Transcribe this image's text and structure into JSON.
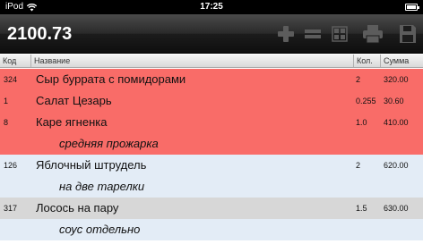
{
  "status_bar": {
    "carrier": "iPod",
    "time": "17:25"
  },
  "toolbar": {
    "total": "2100.73",
    "buttons": [
      {
        "icon": "plus-icon"
      },
      {
        "icon": "list-icon"
      },
      {
        "icon": "grid-icon"
      },
      {
        "icon": "printer-icon"
      },
      {
        "icon": "save-icon"
      }
    ]
  },
  "table": {
    "headers": {
      "code": "Код",
      "name": "Название",
      "qty": "Кол.",
      "sum": "Сумма"
    },
    "rows": [
      {
        "code": "324",
        "name": "Сыр буррата с помидорами",
        "qty": "2",
        "sum": "320.00",
        "color": "#f96c68"
      },
      {
        "code": "1",
        "name": "Салат Цезарь",
        "qty": "0.255",
        "sum": "30.60",
        "color": "#f96c68"
      },
      {
        "code": "8",
        "name": "Каре ягненка",
        "qty": "1.0",
        "sum": "410.00",
        "color": "#f96c68"
      },
      {
        "code": "",
        "name": "средняя прожарка",
        "qty": "",
        "sum": "",
        "note": true,
        "color": "#f96c68"
      },
      {
        "code": "126",
        "name": "Яблочный штрудель",
        "qty": "2",
        "sum": "620.00",
        "color": "#e3ecf6"
      },
      {
        "code": "",
        "name": "на две тарелки",
        "qty": "",
        "sum": "",
        "note": true,
        "color": "#e3ecf6"
      },
      {
        "code": "317",
        "name": "Лосось на пару",
        "qty": "1.5",
        "sum": "630.00",
        "color": "#d7d7d7"
      },
      {
        "code": "",
        "name": "соус отдельно",
        "qty": "",
        "sum": "",
        "note": true,
        "color": "#e3ecf6"
      }
    ]
  }
}
